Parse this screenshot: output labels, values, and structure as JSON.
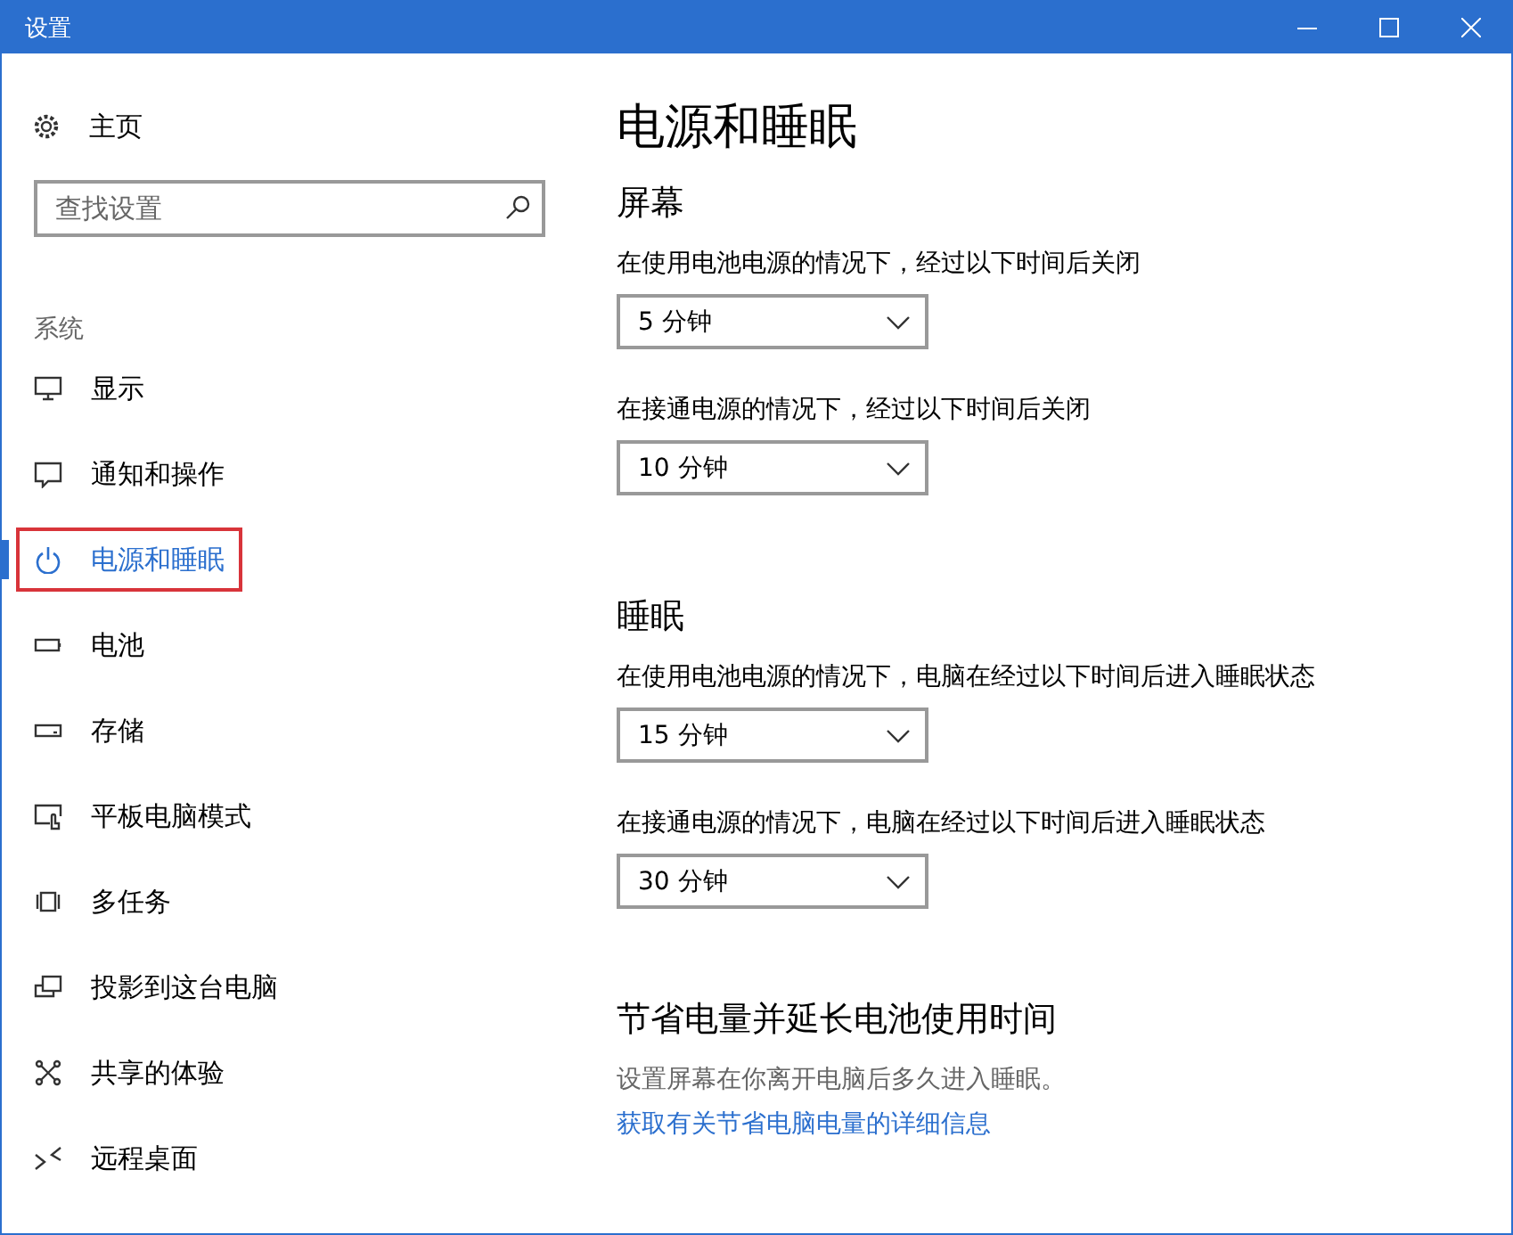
{
  "window": {
    "title": "设置",
    "controls": [
      {
        "kind": "minimize"
      },
      {
        "kind": "maximize"
      },
      {
        "kind": "close"
      }
    ]
  },
  "sidebar": {
    "home": {
      "label": "主页"
    },
    "search": {
      "placeholder": "查找设置"
    },
    "group": "系统",
    "items": [
      {
        "label": "显示",
        "selected": false,
        "highlighted": false
      },
      {
        "label": "通知和操作",
        "selected": false,
        "highlighted": false
      },
      {
        "label": "电源和睡眠",
        "selected": true,
        "highlighted": true
      },
      {
        "label": "电池",
        "selected": false,
        "highlighted": false
      },
      {
        "label": "存储",
        "selected": false,
        "highlighted": false
      },
      {
        "label": "平板电脑模式",
        "selected": false,
        "highlighted": false
      },
      {
        "label": "多任务",
        "selected": false,
        "highlighted": false
      },
      {
        "label": "投影到这台电脑",
        "selected": false,
        "highlighted": false
      },
      {
        "label": "共享的体验",
        "selected": false,
        "highlighted": false
      },
      {
        "label": "远程桌面",
        "selected": false,
        "highlighted": false
      }
    ]
  },
  "content": {
    "title": "电源和睡眠",
    "sections": [
      {
        "heading": "屏幕",
        "settings": [
          {
            "label": "在使用电池电源的情况下，经过以下时间后关闭",
            "value": "5 分钟"
          },
          {
            "label": "在接通电源的情况下，经过以下时间后关闭",
            "value": "10 分钟"
          }
        ]
      },
      {
        "heading": "睡眠",
        "settings": [
          {
            "label": "在使用电池电源的情况下，电脑在经过以下时间后进入睡眠状态",
            "value": "15 分钟"
          },
          {
            "label": "在接通电源的情况下，电脑在经过以下时间后进入睡眠状态",
            "value": "30 分钟"
          }
        ]
      }
    ],
    "tip": {
      "heading": "节省电量并延长电池使用时间",
      "text": "设置屏幕在你离开电脑后多久进入睡眠。",
      "link": "获取有关节省电脑电量的详细信息"
    }
  }
}
